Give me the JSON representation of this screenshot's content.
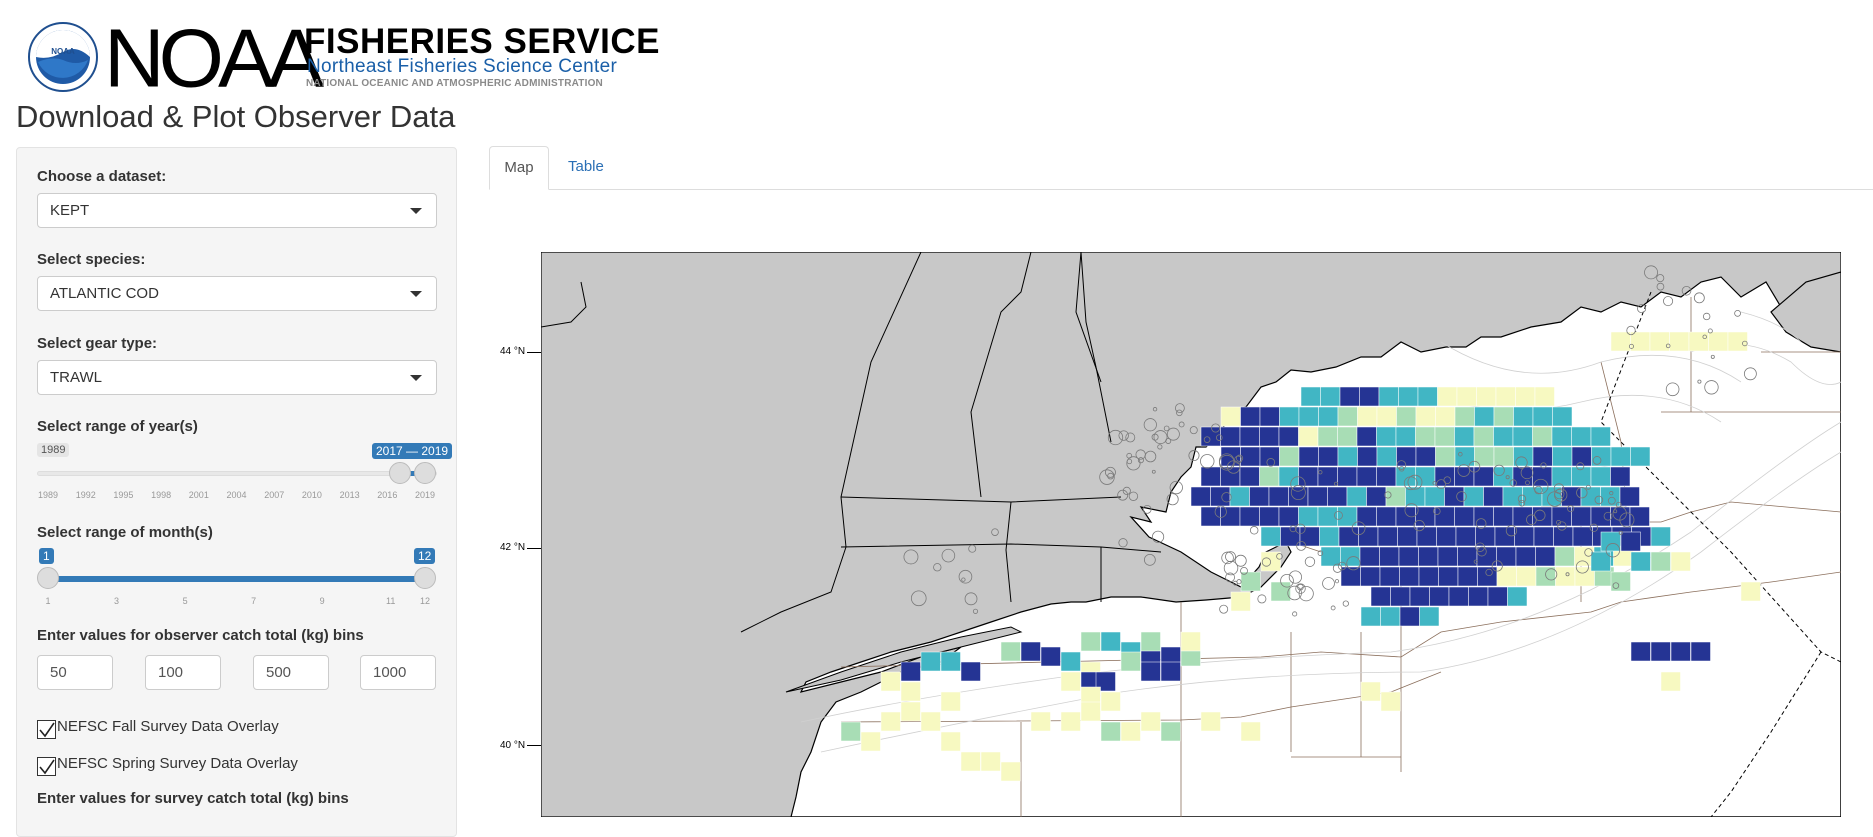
{
  "header": {
    "logo_word": "NOAA",
    "logo_emblem_text": "NOAA",
    "service_title": "FISHERIES SERVICE",
    "center_name": "Northeast Fisheries Science Center",
    "administration": "NATIONAL OCEANIC AND ATMOSPHERIC ADMINISTRATION"
  },
  "page_title": "Download & Plot Observer Data",
  "sidebar": {
    "dataset": {
      "label": "Choose a dataset:",
      "value": "KEPT"
    },
    "species": {
      "label": "Select species:",
      "value": "ATLANTIC COD"
    },
    "gear": {
      "label": "Select gear type:",
      "value": "TRAWL"
    },
    "years": {
      "label": "Select range of year(s)",
      "min_badge": "1989",
      "range_badge": "2017 — 2019",
      "from": 2017,
      "to": 2019,
      "min": 1989,
      "max": 2019,
      "ticks": [
        "1989",
        "1992",
        "1995",
        "1998",
        "2001",
        "2004",
        "2007",
        "2010",
        "2013",
        "2016",
        "2019"
      ]
    },
    "months": {
      "label": "Select range of month(s)",
      "from_badge": "1",
      "to_badge": "12",
      "from": 1,
      "to": 12,
      "min": 1,
      "max": 12,
      "ticks": [
        "1",
        "3",
        "5",
        "7",
        "9",
        "11",
        "12"
      ]
    },
    "observer_bins": {
      "label": "Enter values for observer catch total (kg) bins",
      "values": [
        "50",
        "100",
        "500",
        "1000"
      ]
    },
    "fall_overlay": {
      "label": "NEFSC Fall Survey Data Overlay",
      "checked": true
    },
    "spring_overlay": {
      "label": "NEFSC Spring Survey Data Overlay",
      "checked": true
    },
    "survey_bins": {
      "label": "Enter values for survey catch total (kg) bins"
    }
  },
  "tabs": [
    {
      "label": "Map",
      "active": true
    },
    {
      "label": "Table",
      "active": false
    }
  ],
  "map": {
    "lat_labels": [
      "44 °N",
      "42 °N",
      "40 °N"
    ],
    "colors": {
      "land": "#c8c8c8",
      "bin1": "#f7f9c1",
      "bin2": "#a8ddb5",
      "bin3": "#41b6c4",
      "bin4": "#253494",
      "accent": "#337ab7"
    }
  }
}
